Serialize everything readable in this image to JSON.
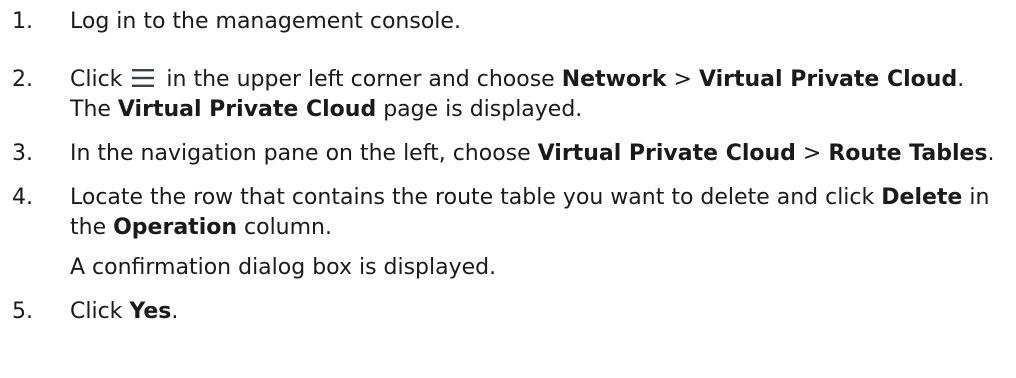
{
  "steps": [
    {
      "number": "1.",
      "text": "Log in to the management console."
    },
    {
      "number": "2.",
      "pre": "Click",
      "icon": "menu-icon",
      "mid": "in the upper left corner and choose",
      "b1": "Network",
      "sep": ">",
      "b2": "Virtual Private Cloud",
      "mid2": ". The",
      "b3": "Virtual Private Cloud",
      "post": "page is displayed."
    },
    {
      "number": "3.",
      "pre": "In the navigation pane on the left, choose",
      "b1": "Virtual Private Cloud",
      "sep": ">",
      "b2": "Route Tables",
      "post": "."
    },
    {
      "number": "4.",
      "pre": "Locate the row that contains the route table you want to delete and click",
      "b1": "Delete",
      "mid": "in the",
      "b2": "Operation",
      "post": "column.",
      "sub": "A confirmation dialog box is displayed."
    },
    {
      "number": "5.",
      "pre": "Click",
      "b1": "Yes",
      "post": "."
    }
  ],
  "colors": {
    "text": "#1a1a1a",
    "icon": "#3a3f4a"
  }
}
